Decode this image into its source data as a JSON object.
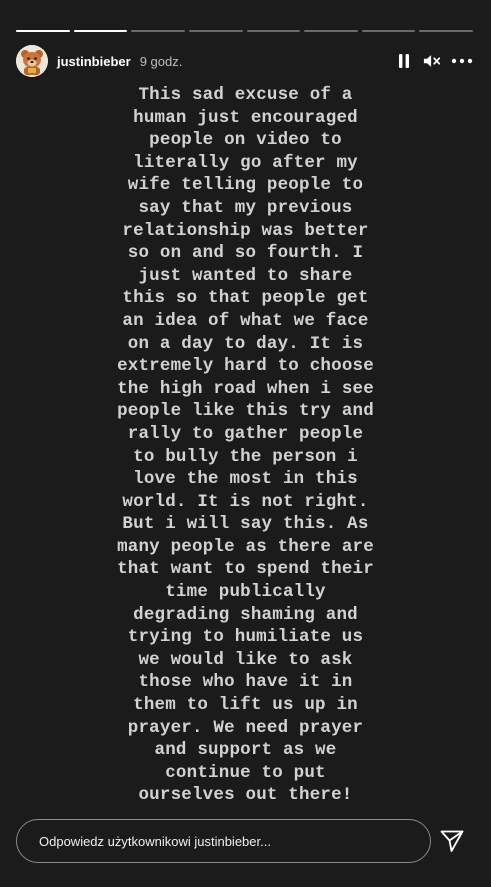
{
  "progress": {
    "segments": [
      1,
      1,
      0,
      0,
      0,
      0,
      0,
      0
    ],
    "active_fraction": 0.0
  },
  "header": {
    "username": "justinbieber",
    "time": "9 godz.",
    "icons": [
      "avatar",
      "pause-icon",
      "mute-icon",
      "more-icon"
    ]
  },
  "story": {
    "text": "This sad excuse of a\nhuman just encouraged\npeople on video to\nliterally go after my\nwife telling people to\nsay that my previous\nrelationship was better\nso on and so fourth. I\njust wanted to share\nthis so that people get\nan idea of what we face\non a day to day. It is\nextremely hard to choose\nthe high road when i see\npeople like this try and\nrally to gather people\nto bully the person i\nlove the most in this\nworld. It is not right.\nBut i will say this. As\nmany people as there are\nthat want to spend their\ntime publically\ndegrading shaming and\ntrying to humiliate us\nwe would like to ask\nthose who have it in\nthem to lift us up in\nprayer. We need prayer\nand support as we\ncontinue to put\nourselves out there!"
  },
  "footer": {
    "reply_placeholder": "Odpowiedz użytkownikowi justinbieber...",
    "send_icon": "send-icon"
  },
  "colors": {
    "background": "#1b1b1b",
    "text": "#d2d2d2",
    "reply_border": "#8a8a8a"
  }
}
